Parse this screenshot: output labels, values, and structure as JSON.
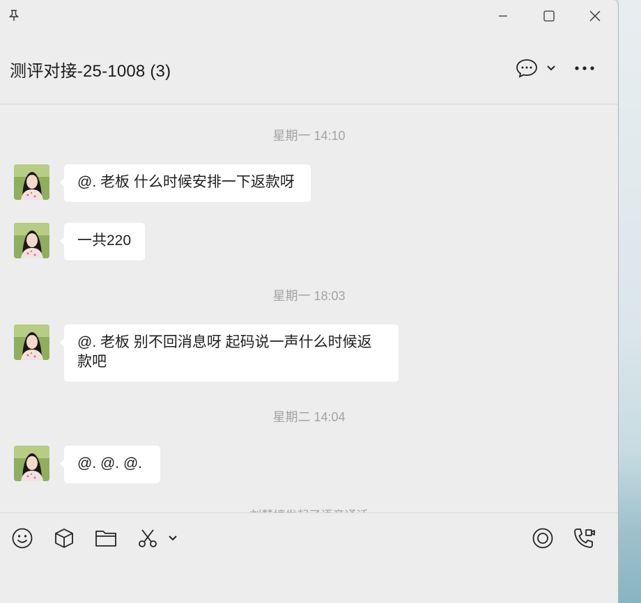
{
  "window": {
    "title": "测评对接-25-1008 (3)"
  },
  "messages": [
    {
      "kind": "timestamp",
      "text": "星期一 14:10"
    },
    {
      "kind": "message",
      "text": "@. 老板  什么时候安排一下返款呀"
    },
    {
      "kind": "message",
      "text": "一共220"
    },
    {
      "kind": "timestamp",
      "text": "星期一 18:03"
    },
    {
      "kind": "message",
      "text": "@. 老板 别不回消息呀 起码说一声什么时候返款吧"
    },
    {
      "kind": "timestamp",
      "text": "星期二 14:04"
    },
    {
      "kind": "message",
      "text": "@.  @.  @."
    },
    {
      "kind": "system",
      "text": "刘慧婷发起了语音通话"
    }
  ],
  "colors": {
    "window_bg": "#ededed",
    "bubble_bg": "#ffffff",
    "timestamp_text": "#a3a3a3"
  }
}
